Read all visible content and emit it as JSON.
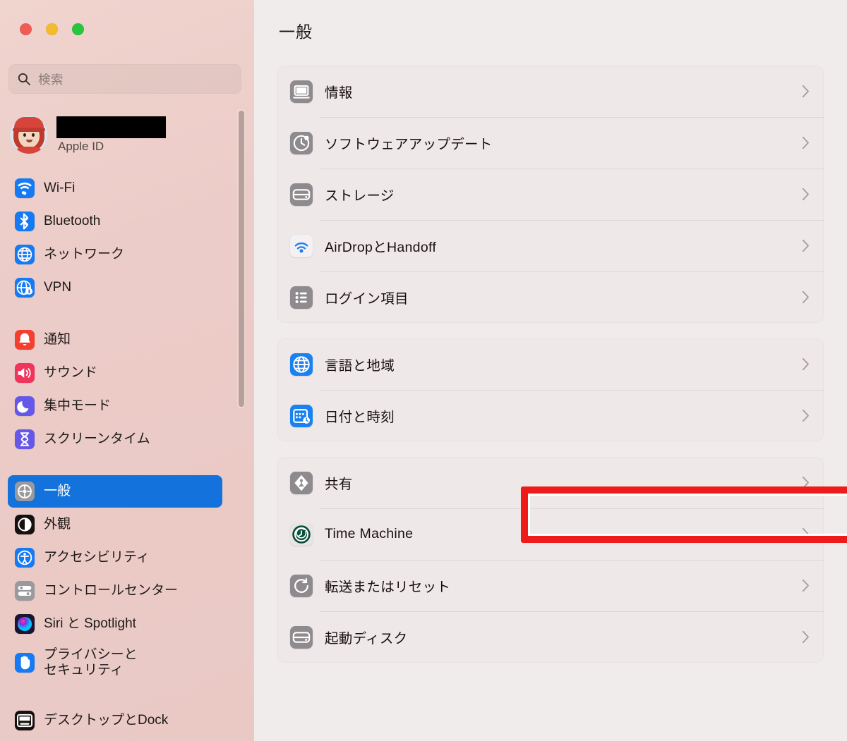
{
  "window": {
    "traffic_lights": [
      {
        "name": "close",
        "color": "#f05b56"
      },
      {
        "name": "minimize",
        "color": "#f5bb2e"
      },
      {
        "name": "zoom",
        "color": "#28c63d"
      }
    ]
  },
  "sidebar": {
    "search": {
      "placeholder": "検索",
      "value": "",
      "icon": "search-icon"
    },
    "profile": {
      "name": "",
      "name_redacted": true,
      "subtitle": "Apple ID",
      "avatar": "memoji-avatar"
    },
    "groups": [
      {
        "items": [
          {
            "label": "Wi-Fi",
            "icon": "wifi-icon",
            "selected": false
          },
          {
            "label": "Bluetooth",
            "icon": "bluetooth-icon",
            "selected": false
          },
          {
            "label": "ネットワーク",
            "icon": "network-globe-icon",
            "selected": false
          },
          {
            "label": "VPN",
            "icon": "vpn-globe-icon",
            "selected": false
          }
        ]
      },
      {
        "items": [
          {
            "label": "通知",
            "icon": "bell-icon",
            "selected": false
          },
          {
            "label": "サウンド",
            "icon": "speaker-icon",
            "selected": false
          },
          {
            "label": "集中モード",
            "icon": "moon-icon",
            "selected": false
          },
          {
            "label": "スクリーンタイム",
            "icon": "hourglass-icon",
            "selected": false
          }
        ]
      },
      {
        "items": [
          {
            "label": "一般",
            "icon": "gear-icon",
            "selected": true
          },
          {
            "label": "外観",
            "icon": "appearance-icon",
            "selected": false
          },
          {
            "label": "アクセシビリティ",
            "icon": "accessibility-icon",
            "selected": false
          },
          {
            "label": "コントロールセンター",
            "icon": "control-center-icon",
            "selected": false
          },
          {
            "label": "Siri と Spotlight",
            "icon": "siri-icon",
            "selected": false
          },
          {
            "label": "プライバシーと\nセキュリティ",
            "icon": "privacy-hand-icon",
            "selected": false
          }
        ]
      },
      {
        "items": [
          {
            "label": "デスクトップとDock",
            "icon": "desktop-dock-icon",
            "selected": false
          }
        ]
      }
    ],
    "accent_color": "#1372db",
    "background_color": "#eacbc7"
  },
  "main": {
    "title": "一般",
    "groups": [
      {
        "rows": [
          {
            "label": "情報",
            "icon": "laptop-icon",
            "icon_color": "#8e8a8e",
            "highlighted": false
          },
          {
            "label": "ソフトウェアアップデート",
            "icon": "software-update-icon",
            "icon_color": "#8e8a8e",
            "highlighted": false
          },
          {
            "label": "ストレージ",
            "icon": "storage-icon",
            "icon_color": "#8e8a8e",
            "highlighted": false
          },
          {
            "label": "AirDropとHandoff",
            "icon": "airdrop-icon",
            "icon_color": "#f2f2f5",
            "highlighted": false
          },
          {
            "label": "ログイン項目",
            "icon": "login-items-icon",
            "icon_color": "#8e8a8e",
            "highlighted": false
          }
        ]
      },
      {
        "rows": [
          {
            "label": "言語と地域",
            "icon": "language-globe-icon",
            "icon_color": "#1a82f0",
            "highlighted": false
          },
          {
            "label": "日付と時刻",
            "icon": "date-time-icon",
            "icon_color": "#1a82f0",
            "highlighted": false
          }
        ]
      },
      {
        "rows": [
          {
            "label": "共有",
            "icon": "sharing-icon",
            "icon_color": "#8e8a8e",
            "highlighted": false
          },
          {
            "label": "Time Machine",
            "icon": "time-machine-icon",
            "icon_color": "#0a5e46",
            "highlighted": true
          },
          {
            "label": "転送またはリセット",
            "icon": "transfer-reset-icon",
            "icon_color": "#8e8a8e",
            "highlighted": false
          },
          {
            "label": "起動ディスク",
            "icon": "startup-disk-icon",
            "icon_color": "#8e8a8e",
            "highlighted": false
          }
        ]
      }
    ],
    "annotation": {
      "target": "Time Machine",
      "shape": "rectangle",
      "color": "#ef1b1b"
    },
    "background_color": "#f1ecec",
    "card_color": "#eee8e8"
  }
}
